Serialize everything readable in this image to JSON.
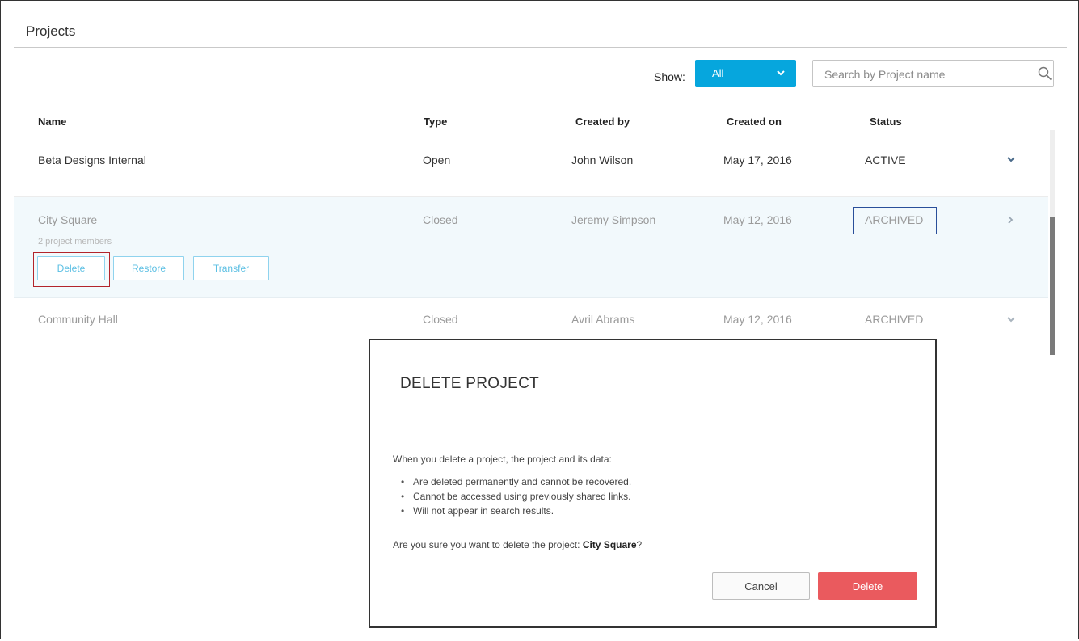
{
  "page": {
    "title": "Projects"
  },
  "filter": {
    "label": "Show:",
    "selected": "All"
  },
  "search": {
    "placeholder": "Search by Project name"
  },
  "table": {
    "headers": [
      "Name",
      "Type",
      "Created by",
      "Created on",
      "Status"
    ],
    "rows": [
      {
        "name": "Beta Designs Internal",
        "type": "Open",
        "created_by": "John Wilson",
        "created_on": "May 17, 2016",
        "status": "ACTIVE"
      },
      {
        "name": "City Square",
        "type": "Closed",
        "created_by": "Jeremy Simpson",
        "created_on": "May 12, 2016",
        "status": "ARCHIVED",
        "members": "2  project members",
        "actions": [
          "Delete",
          "Restore",
          "Transfer"
        ]
      },
      {
        "name": "Community Hall",
        "type": "Closed",
        "created_by": "Avril Abrams",
        "created_on": "May 12, 2016",
        "status": "ARCHIVED"
      }
    ]
  },
  "modal": {
    "title": "DELETE PROJECT",
    "intro": "When you delete a project, the project and its data:",
    "bullets": [
      "Are deleted permanently and cannot be recovered.",
      "Cannot be accessed using previously shared links.",
      "Will not appear in search results."
    ],
    "confirm_prefix": "Are you sure you want to delete the project: ",
    "confirm_project": "City Square",
    "confirm_suffix": "?",
    "cancel_label": "Cancel",
    "delete_label": "Delete"
  },
  "colors": {
    "accent": "#06a6dd",
    "danger": "#ea5a5e",
    "highlight_red": "#b3242b",
    "highlight_blue": "#2a4f9a"
  }
}
